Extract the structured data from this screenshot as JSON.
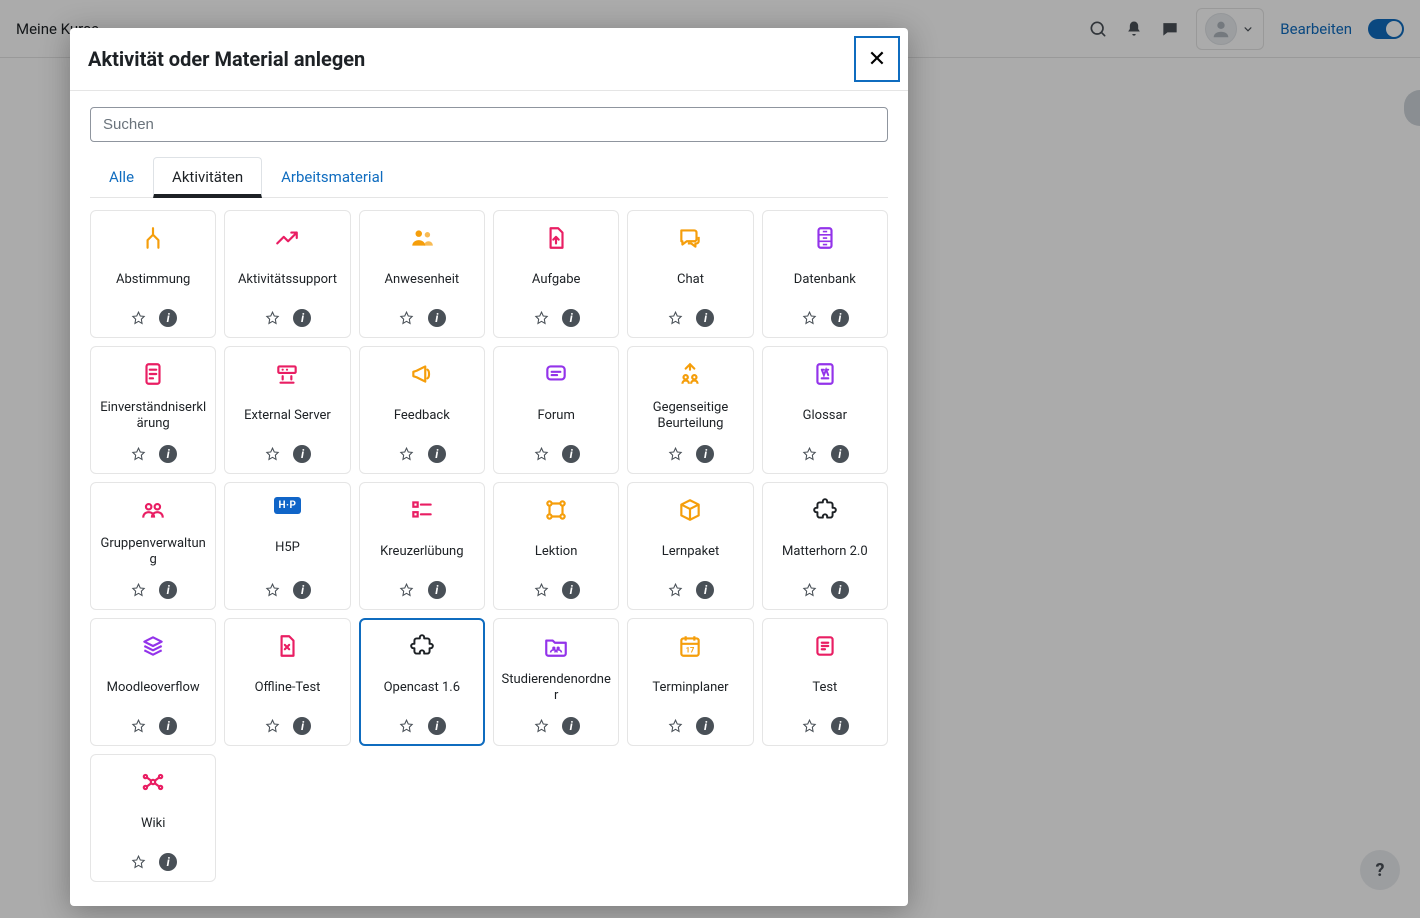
{
  "navbar": {
    "left_link": "Meine Kurse",
    "edit_label": "Bearbeiten"
  },
  "dialog": {
    "title": "Aktivität oder Material anlegen",
    "search_placeholder": "Suchen",
    "tabs": {
      "all": "Alle",
      "activities": "Aktivitäten",
      "resources": "Arbeitsmaterial"
    }
  },
  "activities": [
    {
      "id": "abstimmung",
      "label": "Abstimmung",
      "icon": "choice",
      "color": "c-orange"
    },
    {
      "id": "aktivitaetssupport",
      "label": "Aktivitätssupport",
      "icon": "trend",
      "color": "c-pink"
    },
    {
      "id": "anwesenheit",
      "label": "Anwesenheit",
      "icon": "people",
      "color": "c-orange"
    },
    {
      "id": "aufgabe",
      "label": "Aufgabe",
      "icon": "upload-doc",
      "color": "c-pink"
    },
    {
      "id": "chat",
      "label": "Chat",
      "icon": "chat",
      "color": "c-orange"
    },
    {
      "id": "datenbank",
      "label": "Datenbank",
      "icon": "database",
      "color": "c-purple"
    },
    {
      "id": "einverstaendnis",
      "label": "Einverständniserklärung",
      "icon": "doc-lines",
      "color": "c-pink"
    },
    {
      "id": "external-server",
      "label": "External Server",
      "icon": "server",
      "color": "c-pink"
    },
    {
      "id": "feedback",
      "label": "Feedback",
      "icon": "megaphone",
      "color": "c-orange"
    },
    {
      "id": "forum",
      "label": "Forum",
      "icon": "speech",
      "color": "c-purple"
    },
    {
      "id": "gegenseitige-beurteilung",
      "label": "Gegenseitige Beurteilung",
      "icon": "workshop",
      "color": "c-orange"
    },
    {
      "id": "glossar",
      "label": "Glossar",
      "icon": "glossary",
      "color": "c-purple"
    },
    {
      "id": "gruppenverwaltung",
      "label": "Gruppenverwaltung",
      "icon": "group",
      "color": "c-pink"
    },
    {
      "id": "h5p",
      "label": "H5P",
      "icon": "h5p",
      "color": ""
    },
    {
      "id": "kreuzeruebung",
      "label": "Kreuzerlübung",
      "icon": "checklist",
      "color": "c-pink"
    },
    {
      "id": "lektion",
      "label": "Lektion",
      "icon": "lesson",
      "color": "c-orange"
    },
    {
      "id": "lernpaket",
      "label": "Lernpaket",
      "icon": "package",
      "color": "c-orange"
    },
    {
      "id": "matterhorn",
      "label": "Matterhorn 2.0",
      "icon": "puzzle",
      "color": "c-plain"
    },
    {
      "id": "moodleoverflow",
      "label": "Moodleoverflow",
      "icon": "stack",
      "color": "c-purple"
    },
    {
      "id": "offline-test",
      "label": "Offline-Test",
      "icon": "doc-x",
      "color": "c-pink"
    },
    {
      "id": "opencast",
      "label": "Opencast 1.6",
      "icon": "puzzle",
      "color": "c-plain",
      "selected": true
    },
    {
      "id": "studierendenordner",
      "label": "Studierendenordner",
      "icon": "folder-people",
      "color": "c-purple"
    },
    {
      "id": "terminplaner",
      "label": "Terminplaner",
      "icon": "calendar",
      "color": "c-orange"
    },
    {
      "id": "test",
      "label": "Test",
      "icon": "quiz",
      "color": "c-pink"
    },
    {
      "id": "wiki",
      "label": "Wiki",
      "icon": "network",
      "color": "c-pink"
    }
  ],
  "help": {
    "label": "?"
  }
}
